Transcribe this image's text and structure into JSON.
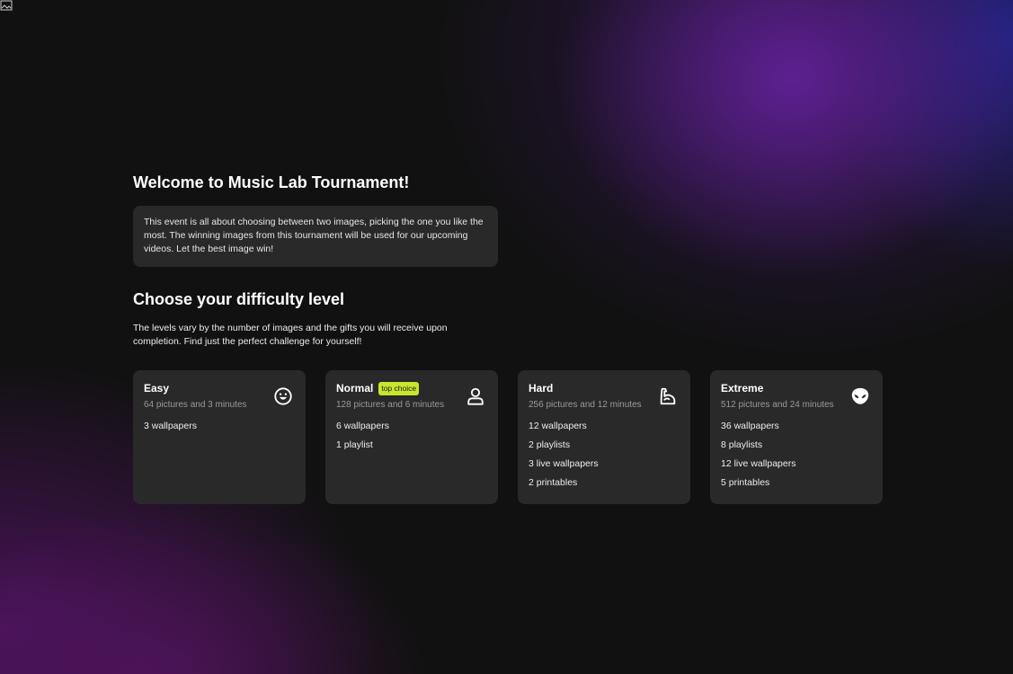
{
  "header": {
    "corner_icon": "broken-image-icon"
  },
  "welcome": {
    "title": "Welcome to Music Lab Tournament!",
    "description": "This event is all about choosing between two images, picking the one you like the most. The winning images from this tournament will be used for our upcoming videos. Let the best image win!"
  },
  "difficulty": {
    "title": "Choose your difficulty level",
    "description": "The levels vary by the number of images and the gifts you will receive upon completion. Find just the perfect challenge for yourself!",
    "levels": [
      {
        "name": "Easy",
        "badge": "",
        "subtitle": "64 pictures and 3 minutes",
        "icon": "smiley-icon",
        "rewards": [
          "3 wallpapers"
        ]
      },
      {
        "name": "Normal",
        "badge": "top choice",
        "subtitle": "128 pictures and 6 minutes",
        "icon": "person-icon",
        "rewards": [
          "6 wallpapers",
          "1 playlist"
        ]
      },
      {
        "name": "Hard",
        "badge": "",
        "subtitle": "256 pictures and 12 minutes",
        "icon": "flexed-arm-icon",
        "rewards": [
          "12 wallpapers",
          "2 playlists",
          "3 live wallpapers",
          "2 printables"
        ]
      },
      {
        "name": "Extreme",
        "badge": "",
        "subtitle": "512 pictures and 24 minutes",
        "icon": "alien-icon",
        "rewards": [
          "36 wallpapers",
          "8 playlists",
          "12 live wallpapers",
          "5 printables"
        ]
      }
    ]
  },
  "colors": {
    "background": "#111111",
    "card": "#292929",
    "badge": "#c8e62c",
    "subtitle": "#9a9a9a"
  }
}
